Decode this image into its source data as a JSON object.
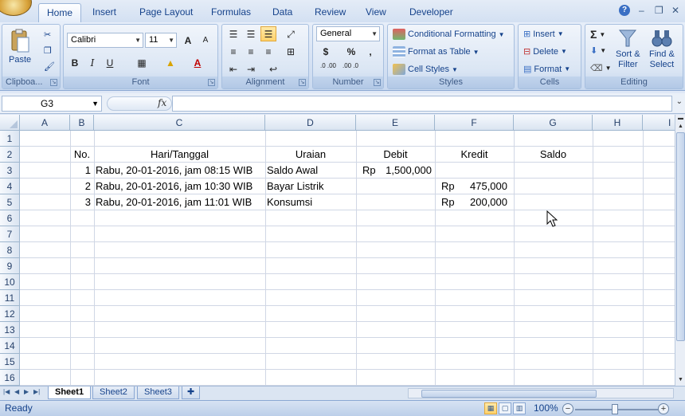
{
  "tabs": [
    "Home",
    "Insert",
    "Page Layout",
    "Formulas",
    "Data",
    "Review",
    "View",
    "Developer"
  ],
  "active_tab": "Home",
  "ribbon": {
    "clipboard": {
      "label": "Clipboa...",
      "paste": "Paste"
    },
    "font": {
      "label": "Font",
      "name": "Calibri",
      "size": "11",
      "bold": "B",
      "italic": "I",
      "underline": "U",
      "grow": "A",
      "shrink": "A"
    },
    "alignment": {
      "label": "Alignment"
    },
    "number": {
      "label": "Number",
      "format": "General",
      "currency": "$",
      "percent": "%",
      "comma": ",",
      "inc_decimal": ".0 .00",
      "dec_decimal": ".00 .0"
    },
    "styles": {
      "label": "Styles",
      "conditional": "Conditional Formatting",
      "format_table": "Format as Table",
      "cell_styles": "Cell Styles"
    },
    "cells": {
      "label": "Cells",
      "insert": "Insert",
      "delete": "Delete",
      "format": "Format"
    },
    "editing": {
      "label": "Editing",
      "sort1": "Sort &",
      "sort2": "Filter",
      "find1": "Find &",
      "find2": "Select",
      "sum": "Σ"
    }
  },
  "formula_bar": {
    "name_box": "G3",
    "fx": "fx",
    "formula": ""
  },
  "columns": [
    "A",
    "B",
    "C",
    "D",
    "E",
    "F",
    "G",
    "H",
    "I"
  ],
  "rows": [
    "1",
    "2",
    "3",
    "4",
    "5",
    "6",
    "7",
    "8",
    "9",
    "10",
    "11",
    "12",
    "13",
    "14",
    "15",
    "16"
  ],
  "headers": {
    "no": "No.",
    "date": "Hari/Tanggal",
    "desc": "Uraian",
    "debit": "Debit",
    "credit": "Kredit",
    "balance": "Saldo"
  },
  "entries": [
    {
      "no": "1",
      "date": "Rabu, 20-01-2016, jam 08:15 WIB",
      "desc": "Saldo Awal",
      "debit_cur": "Rp",
      "debit": "1,500,000",
      "credit_cur": "",
      "credit": ""
    },
    {
      "no": "2",
      "date": "Rabu, 20-01-2016, jam 10:30 WIB",
      "desc": "Bayar Listrik",
      "debit_cur": "",
      "debit": "",
      "credit_cur": "Rp",
      "credit": "475,000"
    },
    {
      "no": "3",
      "date": "Rabu, 20-01-2016, jam 11:01 WIB",
      "desc": "Konsumsi",
      "debit_cur": "",
      "debit": "",
      "credit_cur": "Rp",
      "credit": "200,000"
    }
  ],
  "sheets": [
    "Sheet1",
    "Sheet2",
    "Sheet3"
  ],
  "active_sheet": "Sheet1",
  "status": {
    "text": "Ready",
    "zoom": "100%"
  }
}
